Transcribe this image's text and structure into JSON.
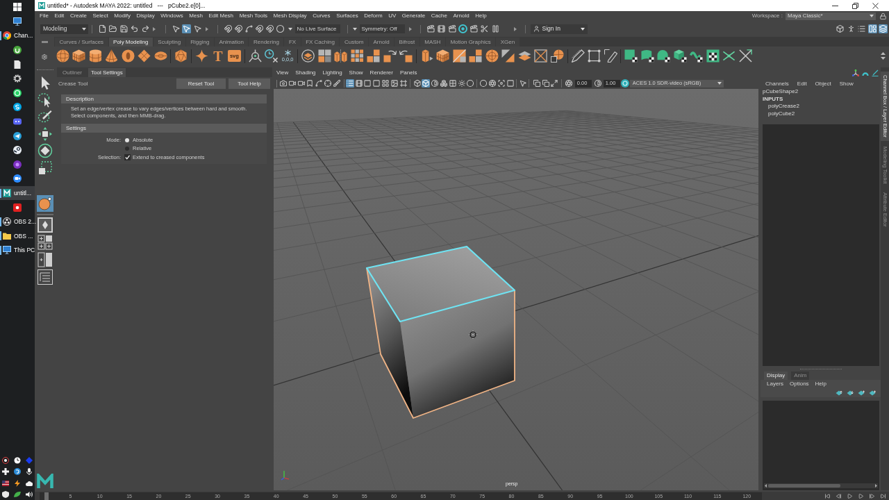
{
  "taskbar": {
    "apps": [
      {
        "label": "Chan...",
        "selected": false,
        "running": true
      },
      {
        "label": "untitl...",
        "selected": true,
        "running": true
      },
      {
        "label": "OBS 2...",
        "selected": false,
        "running": true
      },
      {
        "label": "OBS ...",
        "selected": false,
        "running": true
      },
      {
        "label": "This PC",
        "selected": false,
        "running": true
      }
    ]
  },
  "window": {
    "title": "untitled* - Autodesk MAYA 2022: untitled   ---   pCube2.e[0]..."
  },
  "menu_bar": {
    "items": [
      "File",
      "Edit",
      "Create",
      "Select",
      "Modify",
      "Display",
      "Windows",
      "Mesh",
      "Edit Mesh",
      "Mesh Tools",
      "Mesh Display",
      "Curves",
      "Surfaces",
      "Deform",
      "UV",
      "Generate",
      "Cache",
      "Arnold",
      "Help"
    ],
    "workspace_label": "Workspace :",
    "workspace": "Maya Classic*"
  },
  "status_line": {
    "menu_set": "Modeling",
    "selection_masks": [
      {
        "selected": false
      },
      {
        "selected": true
      },
      {
        "selected": false
      }
    ],
    "live_surface": "No Live Surface",
    "symmetry": "Symmetry: Off",
    "sign_in": "Sign In",
    "panel_toggles": [
      {
        "selected": false
      },
      {
        "selected": false
      },
      {
        "selected": false
      },
      {
        "selected": true
      },
      {
        "selected": true
      }
    ]
  },
  "shelf": {
    "tabs": [
      {
        "label": "Curves / Surfaces",
        "selected": false
      },
      {
        "label": "Poly Modeling",
        "selected": true
      },
      {
        "label": "Sculpting",
        "selected": false
      },
      {
        "label": "Rigging",
        "selected": false
      },
      {
        "label": "Animation",
        "selected": false
      },
      {
        "label": "Rendering",
        "selected": false
      },
      {
        "label": "FX",
        "selected": false
      },
      {
        "label": "FX Caching",
        "selected": false
      },
      {
        "label": "Custom",
        "selected": false
      },
      {
        "label": "Arnold",
        "selected": false
      },
      {
        "label": "Bifrost",
        "selected": false
      },
      {
        "label": "MASH",
        "selected": false
      },
      {
        "label": "Motion Graphics",
        "selected": false
      },
      {
        "label": "XGen",
        "selected": false
      }
    ],
    "icon_texts": [
      "T",
      "svg",
      "0,0,0"
    ]
  },
  "toolbox": {
    "tools": [
      {
        "selected": false
      },
      {
        "selected": false
      },
      {
        "selected": false
      },
      {
        "selected": false
      },
      {
        "selected": false
      },
      {
        "selected": false
      },
      {
        "selected": true
      }
    ]
  },
  "tool_settings": {
    "tabs": [
      {
        "label": "Outliner",
        "selected": false
      },
      {
        "label": "Tool Settings",
        "selected": true
      }
    ],
    "tool_name": "Crease Tool",
    "buttons": [
      "Reset Tool",
      "Tool Help"
    ],
    "description": {
      "title": "Description",
      "lines": [
        "Set an edge/vertex crease to vary edges/vertices between hard and smooth.",
        "Select components, and then MMB-drag."
      ]
    },
    "settings": {
      "title": "Settings",
      "mode_label": "Mode:",
      "modes": [
        {
          "label": "Absolute",
          "selected": true
        },
        {
          "label": "Relative",
          "selected": false
        }
      ],
      "selection_label": "Selection:",
      "extend": {
        "label": "Extend to creased components",
        "checked": true
      }
    }
  },
  "viewport": {
    "menu": [
      "View",
      "Shading",
      "Lighting",
      "Show",
      "Renderer",
      "Panels"
    ],
    "toggles": [
      {
        "on": true
      },
      {
        "on": false
      },
      {
        "on": true
      }
    ],
    "exposure": "0.00",
    "gamma": "1.00",
    "color_space": "ACES 1.0 SDR-video (sRGB)",
    "camera": "persp"
  },
  "channel_box": {
    "menu": [
      "Channels",
      "Edit",
      "Object",
      "Show"
    ],
    "object": "pCubeShape2",
    "inputs_header": "INPUTS",
    "inputs": [
      "polyCrease2",
      "polyCube2"
    ]
  },
  "layer_editor": {
    "tabs": [
      {
        "label": "Display",
        "selected": true
      },
      {
        "label": "Anim",
        "selected": false
      }
    ],
    "menu": [
      "Layers",
      "Options",
      "Help"
    ]
  },
  "side_tabs": [
    {
      "label": "Channel Box / Layer Editor",
      "selected": true
    },
    {
      "label": "Modeling Toolkit",
      "selected": false
    },
    {
      "label": "Attribute Editor",
      "selected": false
    }
  ],
  "time_slider": {
    "level": 0.0083,
    "ticks": [
      "5",
      "10",
      "15",
      "20",
      "25",
      "30",
      "35",
      "40",
      "45",
      "50",
      "55",
      "60",
      "65",
      "70",
      "75",
      "80",
      "85",
      "90",
      "95",
      "100",
      "105",
      "110",
      "115",
      "120"
    ]
  }
}
